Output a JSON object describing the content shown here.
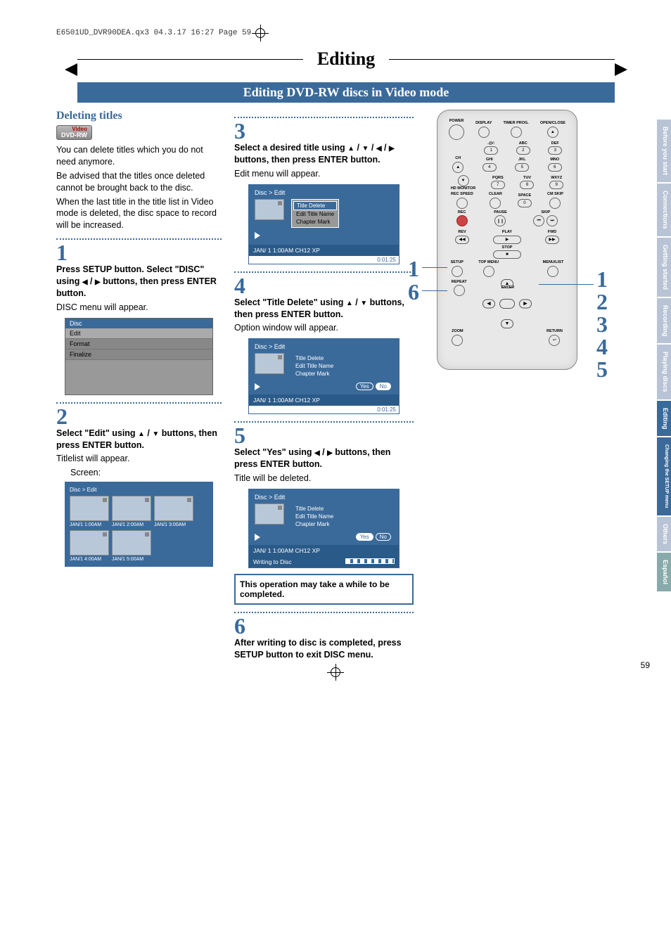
{
  "header_line": "E6501UD_DVR90DEA.qx3  04.3.17  16:27  Page 59",
  "title": "Editing",
  "subtitle": "Editing DVD-RW discs in Video mode",
  "section_heading": "Deleting titles",
  "dvd_badge_top": "Video",
  "dvd_badge_bottom": "DVD-RW",
  "intro_p1": "You can delete titles which you do not need anymore.",
  "intro_p2": "Be advised that the titles once deleted cannot be brought back to the disc.",
  "intro_p3": "When the last title in the title list in Video mode is deleted, the disc space to record will be increased.",
  "step1_num": "1",
  "step1_text_a": "Press SETUP button. Select \"DISC\" using ",
  "step1_text_b": " / ",
  "step1_text_c": " buttons, then press ENTER button.",
  "step1_after": "DISC menu will appear.",
  "disc_menu_header": "Disc",
  "disc_menu_items": [
    "Edit",
    "Format",
    "Finalize"
  ],
  "step2_num": "2",
  "step2_text_a": "Select \"Edit\" using ",
  "step2_text_b": " / ",
  "step2_text_c": " buttons, then press ENTER button.",
  "step2_after": "Titlelist will appear.",
  "step2_screen": "Screen:",
  "titlelist_header": "Disc > Edit",
  "titlelist_items": [
    {
      "cap": "JAN/1   1:00AM"
    },
    {
      "cap": "JAN/1   2:00AM"
    },
    {
      "cap": "JAN/1   3:00AM"
    },
    {
      "cap": "JAN/1   4:00AM"
    },
    {
      "cap": "JAN/1   5:00AM"
    }
  ],
  "step3_num": "3",
  "step3_text_a": "Select a desired title using ",
  "step3_text_b": " / ",
  "step3_text_c": " / ",
  "step3_text_d": " / ",
  "step3_text_e": " buttons, then press ENTER button.",
  "step3_after": "Edit menu will appear.",
  "osd_header": "Disc > Edit",
  "osd_menu_items": [
    "Title Delete",
    "Edit Title Name",
    "Chapter Mark"
  ],
  "osd_status_left": "JAN/ 1   1:00AM  CH12      XP",
  "osd_time": "0:01:25",
  "step4_num": "4",
  "step4_text_a": "Select \"Title Delete\" using ",
  "step4_text_b": " / ",
  "step4_text_c": " buttons, then press ENTER button.",
  "step4_after": "Option window will appear.",
  "yes_label": "Yes",
  "no_label": "No",
  "step5_num": "5",
  "step5_text_a": "Select \"Yes\" using ",
  "step5_text_b": " / ",
  "step5_text_c": " buttons, then press ENTER button.",
  "step5_after": "Title will be deleted.",
  "writing_label": "Writing to Disc",
  "note_line1": "This operation may take a while to be completed.",
  "step6_num": "6",
  "step6_text": "After writing to disc is completed, press SETUP button to exit DISC menu.",
  "remote": {
    "labels": {
      "power": "POWER",
      "openclose": "OPEN/CLOSE",
      "display": "DISPLAY",
      "timerprog": "TIMER PROG.",
      "ch": "CH",
      "hdmonitor": "HD MONITOR",
      "recspeed": "REC SPEED",
      "clear": "CLEAR",
      "space": "SPACE",
      "cmskip": "CM SKIP",
      "rec": "REC",
      "pause": "PAUSE",
      "skip": "SKIP",
      "play": "PLAY",
      "rev": "REV",
      "fwd": "FWD",
      "stop": "STOP",
      "setup": "SETUP",
      "topmenu": "TOP MENU",
      "menulist": "MENU/LIST",
      "repeat": "REPEAT",
      "enter": "ENTER",
      "zoom": "ZOOM",
      "return": "RETURN",
      "at": ".@/:",
      "abc": "ABC",
      "def": "DEF",
      "ghi": "GHI",
      "jkl": "JKL",
      "mno": "MNO",
      "pqrs": "PQRS",
      "tuv": "TUV",
      "wxyz": "WXYZ"
    },
    "nums": [
      "1",
      "2",
      "3",
      "4",
      "5",
      "6",
      "7",
      "8",
      "9",
      "0"
    ]
  },
  "callouts_left": [
    "1",
    "6"
  ],
  "callouts_right": [
    "1",
    "2",
    "3",
    "4",
    "5"
  ],
  "side_tabs": [
    {
      "label": "Before you start",
      "active": false
    },
    {
      "label": "Connections",
      "active": false
    },
    {
      "label": "Getting started",
      "active": false
    },
    {
      "label": "Recording",
      "active": false
    },
    {
      "label": "Playing discs",
      "active": false
    },
    {
      "label": "Editing",
      "active": true
    },
    {
      "label": "Changing the SETUP menu",
      "active": true,
      "sub": true
    },
    {
      "label": "Others",
      "active": false
    },
    {
      "label": "Español",
      "active": false,
      "es": true
    }
  ],
  "page_number": "59"
}
